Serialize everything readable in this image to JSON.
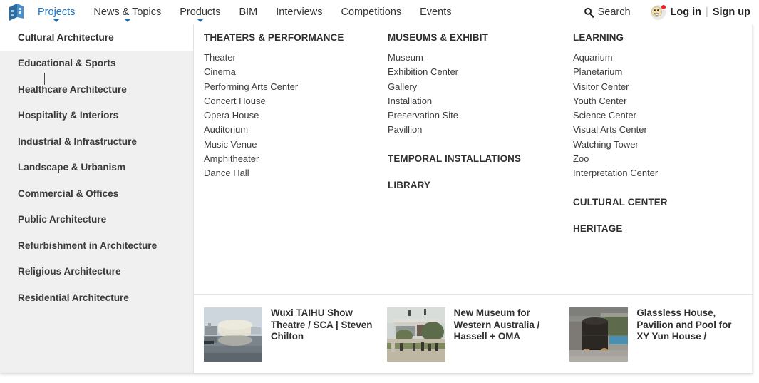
{
  "nav": {
    "logo_icon": "building-cube-logo",
    "items": [
      {
        "label": "Projects",
        "active": true,
        "has_caret": true
      },
      {
        "label": "News & Topics",
        "active": false,
        "has_caret": true
      },
      {
        "label": "Products",
        "active": false,
        "has_caret": true
      },
      {
        "label": "BIM",
        "active": false,
        "has_caret": false
      },
      {
        "label": "Interviews",
        "active": false,
        "has_caret": false
      },
      {
        "label": "Competitions",
        "active": false,
        "has_caret": false
      },
      {
        "label": "Events",
        "active": false,
        "has_caret": false
      }
    ],
    "search_label": "Search",
    "search_icon": "search-icon",
    "login_label": "Log in",
    "separator": "|",
    "signup_label": "Sign up",
    "avatar_icon": "user-avatar-icon",
    "notification_badge_color": "#e8242a",
    "accent_color": "#1a73c4"
  },
  "sidebar": {
    "items": [
      {
        "label": "Cultural Architecture",
        "active": true
      },
      {
        "label": "Educational & Sports",
        "active": false
      },
      {
        "label": "Healthcare Architecture",
        "active": false
      },
      {
        "label": "Hospitality & Interiors",
        "active": false
      },
      {
        "label": "Industrial & Infrastructure",
        "active": false
      },
      {
        "label": "Landscape & Urbanism",
        "active": false
      },
      {
        "label": "Commercial & Offices",
        "active": false
      },
      {
        "label": "Public Architecture",
        "active": false
      },
      {
        "label": "Refurbishment in Architecture",
        "active": false
      },
      {
        "label": "Religious Architecture",
        "active": false
      },
      {
        "label": "Residential Architecture",
        "active": false
      }
    ]
  },
  "columns": [
    {
      "groups": [
        {
          "heading": "THEATERS & PERFORMANCE",
          "links": [
            "Theater",
            "Cinema",
            "Performing Arts Center",
            "Concert House",
            "Opera House",
            "Auditorium",
            "Music Venue",
            "Amphitheater",
            "Dance Hall"
          ]
        }
      ]
    },
    {
      "groups": [
        {
          "heading": "MUSEUMS & EXHIBIT",
          "links": [
            "Museum",
            "Exhibition Center",
            "Gallery",
            "Installation",
            "Preservation Site",
            "Pavillion"
          ]
        },
        {
          "heading": "TEMPORAL INSTALLATIONS",
          "links": []
        },
        {
          "heading": "LIBRARY",
          "links": []
        }
      ]
    },
    {
      "groups": [
        {
          "heading": "LEARNING",
          "links": [
            "Aquarium",
            "Planetarium",
            "Visitor Center",
            "Youth Center",
            "Science Center",
            "Visual Arts Center",
            "Watching Tower",
            "Zoo",
            "Interpretation Center"
          ]
        },
        {
          "heading": "CULTURAL CENTER",
          "links": []
        },
        {
          "heading": "HERITAGE",
          "links": []
        }
      ]
    }
  ],
  "featured": [
    {
      "title": "Wuxi TAIHU Show Theatre / SCA | Steven Chilton",
      "thumb_alt": "circular-theatre-on-lake-photo"
    },
    {
      "title": "New Museum for Western Australia / Hassell + OMA",
      "thumb_alt": "museum-plaza-photo"
    },
    {
      "title": "Glassless House, Pavilion and Pool for XY Yun House /",
      "thumb_alt": "dark-cylinder-pavilion-photo"
    }
  ]
}
